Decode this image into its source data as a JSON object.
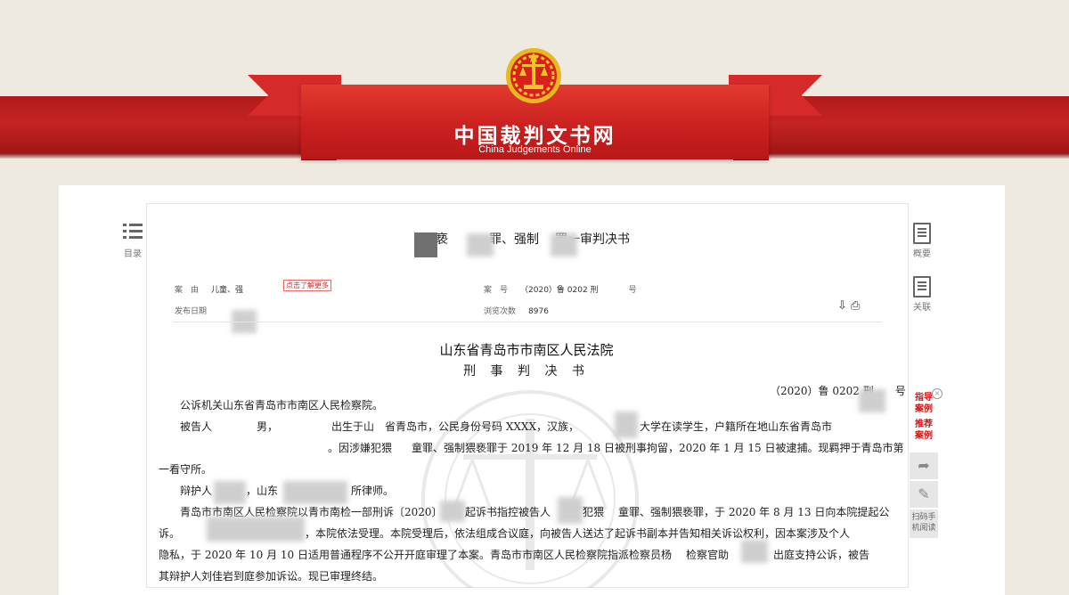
{
  "site": {
    "title_cn": "中国裁判文书网",
    "title_en": "China Judgements Online"
  },
  "sidebar_left": {
    "toc_label": "目录"
  },
  "sidebar_right": {
    "overview_label": "概要",
    "related_label": "关联"
  },
  "document": {
    "title_parts": [
      "猥亵",
      "罪、强制",
      "罪一审判决书"
    ],
    "meta": {
      "cause_label": "案　由",
      "cause_value": "儿童、强",
      "learn_more": "点击了解更多",
      "case_no_label": "案　号",
      "case_no_value": "（2020）鲁 0202 刑",
      "case_no_suffix": "号",
      "publish_label": "发布日期",
      "views_label": "浏览次数",
      "views_value": "8976"
    },
    "court": "山东省青岛市市南区人民法院",
    "doc_type": "刑 事 判 决 书",
    "case_number": "（2020）鲁 0202 刑",
    "case_number_suffix": "号",
    "paragraphs": [
      "公诉机关山东省青岛市市南区人民检察院。",
      "被告人",
      "男，",
      "出生于山",
      "省青岛市，公民身份号码 XXXX，汉族，",
      "大学在读学生，户籍所在地山东省青岛市",
      "。因涉嫌犯猥",
      "童罪、强制猥亵罪于 2019 年 12 月 18 日被刑事拘留，2020 年 1 月 15 日被逮捕。现羁押于青岛市第",
      "一看守所。",
      "辩护人",
      "，山东",
      "所律师。",
      "青岛市市南区人民检察院以青市南检一部刑诉〔2020〕",
      "起诉书指控被告人",
      "犯猥",
      "童罪、强制猥亵罪，于 2020 年 8 月 13 日向本院提起公",
      "诉。",
      "，本院依法受理。本院受理后，依法组成合议庭，向被告人送达了起诉书副本并告知相关诉讼权利，因本案涉及个人",
      "隐私，于 2020 年 10 月 10 日适用普通程序不公开开庭审理了本案。青岛市市南区人民检察院指派检察员杨",
      "检察官助",
      "出庭支持公诉，被告",
      "其辩护人刘佳岩到庭参加诉讼。现已审理终结。"
    ]
  },
  "float_panel": {
    "guide_label_1": "指导",
    "guide_label_2": "案例",
    "recommend_label_1": "推荐",
    "recommend_label_2": "案例",
    "scan_label_1": "扫码手",
    "scan_label_2": "机阅读"
  },
  "colors": {
    "brand_red": "#c81f1f",
    "page_bg": "#efeae0",
    "link_red": "#d41414"
  }
}
